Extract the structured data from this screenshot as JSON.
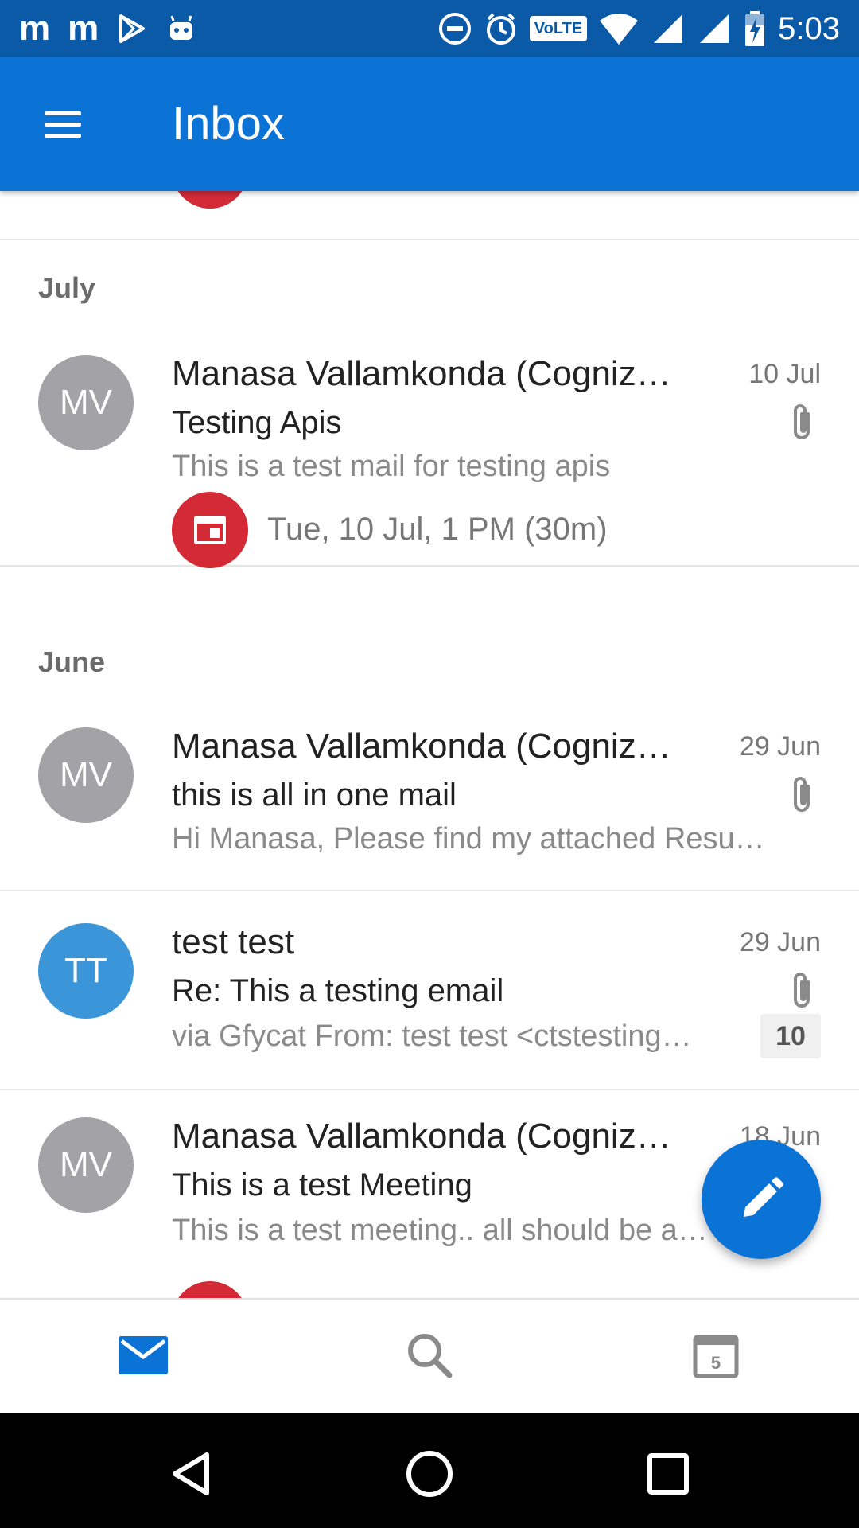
{
  "status_bar": {
    "left_glyphs": [
      "m",
      "m"
    ],
    "time": "5:03",
    "volte": "VoLTE"
  },
  "app_bar": {
    "title": "Inbox"
  },
  "sections": {
    "july": "July",
    "june": "June"
  },
  "emails": [
    {
      "initials": "MV",
      "sender": "Manasa Vallamkonda (Cogniz…",
      "date": "10 Jul",
      "subject": "Testing Apis",
      "preview": "This is a test mail for testing apis",
      "event": "Tue, 10 Jul, 1 PM (30m)",
      "avatar_color": "#a3a2a7"
    },
    {
      "initials": "MV",
      "sender": "Manasa Vallamkonda (Cogniz…",
      "date": "29 Jun",
      "subject": "this is all in one mail",
      "preview": "Hi Manasa, Please find my attached Resu…",
      "avatar_color": "#a3a2a7"
    },
    {
      "initials": "TT",
      "sender": "test test",
      "date": "29 Jun",
      "subject": "Re: This a testing email",
      "preview": "via Gfycat From: test test <ctstesting…",
      "count": "10",
      "avatar_color": "#3a96d9"
    },
    {
      "initials": "MV",
      "sender": "Manasa Vallamkonda (Cogniz…",
      "date": "18 Jun",
      "subject": "This is a test Meeting",
      "preview": "This is a test meeting.. all should be a…",
      "avatar_color": "#a3a2a7"
    }
  ],
  "icons": {
    "menu": "hamburger-icon",
    "attachment": "paperclip-icon",
    "compose": "pencil-icon",
    "mail_tab": "mail-icon",
    "search_tab": "search-icon",
    "calendar_tab": "calendar-icon"
  },
  "bottom_tabs": {
    "calendar_day": "5"
  },
  "colors": {
    "status_bar": "#0a5aa8",
    "app_bar": "#0b72d6",
    "event_red": "#d32a36"
  }
}
